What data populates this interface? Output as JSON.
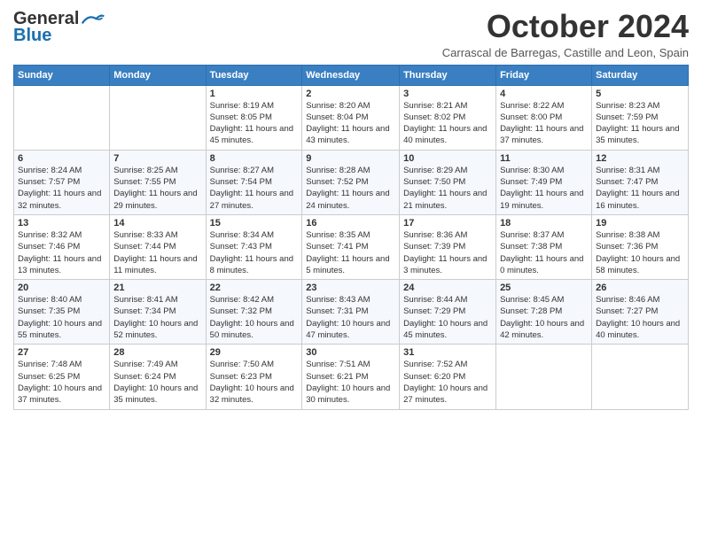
{
  "header": {
    "logo_general": "General",
    "logo_blue": "Blue",
    "month_title": "October 2024",
    "subtitle": "Carrascal de Barregas, Castille and Leon, Spain"
  },
  "days_of_week": [
    "Sunday",
    "Monday",
    "Tuesday",
    "Wednesday",
    "Thursday",
    "Friday",
    "Saturday"
  ],
  "weeks": [
    [
      {
        "day": "",
        "info": ""
      },
      {
        "day": "",
        "info": ""
      },
      {
        "day": "1",
        "info": "Sunrise: 8:19 AM\nSunset: 8:05 PM\nDaylight: 11 hours and 45 minutes."
      },
      {
        "day": "2",
        "info": "Sunrise: 8:20 AM\nSunset: 8:04 PM\nDaylight: 11 hours and 43 minutes."
      },
      {
        "day": "3",
        "info": "Sunrise: 8:21 AM\nSunset: 8:02 PM\nDaylight: 11 hours and 40 minutes."
      },
      {
        "day": "4",
        "info": "Sunrise: 8:22 AM\nSunset: 8:00 PM\nDaylight: 11 hours and 37 minutes."
      },
      {
        "day": "5",
        "info": "Sunrise: 8:23 AM\nSunset: 7:59 PM\nDaylight: 11 hours and 35 minutes."
      }
    ],
    [
      {
        "day": "6",
        "info": "Sunrise: 8:24 AM\nSunset: 7:57 PM\nDaylight: 11 hours and 32 minutes."
      },
      {
        "day": "7",
        "info": "Sunrise: 8:25 AM\nSunset: 7:55 PM\nDaylight: 11 hours and 29 minutes."
      },
      {
        "day": "8",
        "info": "Sunrise: 8:27 AM\nSunset: 7:54 PM\nDaylight: 11 hours and 27 minutes."
      },
      {
        "day": "9",
        "info": "Sunrise: 8:28 AM\nSunset: 7:52 PM\nDaylight: 11 hours and 24 minutes."
      },
      {
        "day": "10",
        "info": "Sunrise: 8:29 AM\nSunset: 7:50 PM\nDaylight: 11 hours and 21 minutes."
      },
      {
        "day": "11",
        "info": "Sunrise: 8:30 AM\nSunset: 7:49 PM\nDaylight: 11 hours and 19 minutes."
      },
      {
        "day": "12",
        "info": "Sunrise: 8:31 AM\nSunset: 7:47 PM\nDaylight: 11 hours and 16 minutes."
      }
    ],
    [
      {
        "day": "13",
        "info": "Sunrise: 8:32 AM\nSunset: 7:46 PM\nDaylight: 11 hours and 13 minutes."
      },
      {
        "day": "14",
        "info": "Sunrise: 8:33 AM\nSunset: 7:44 PM\nDaylight: 11 hours and 11 minutes."
      },
      {
        "day": "15",
        "info": "Sunrise: 8:34 AM\nSunset: 7:43 PM\nDaylight: 11 hours and 8 minutes."
      },
      {
        "day": "16",
        "info": "Sunrise: 8:35 AM\nSunset: 7:41 PM\nDaylight: 11 hours and 5 minutes."
      },
      {
        "day": "17",
        "info": "Sunrise: 8:36 AM\nSunset: 7:39 PM\nDaylight: 11 hours and 3 minutes."
      },
      {
        "day": "18",
        "info": "Sunrise: 8:37 AM\nSunset: 7:38 PM\nDaylight: 11 hours and 0 minutes."
      },
      {
        "day": "19",
        "info": "Sunrise: 8:38 AM\nSunset: 7:36 PM\nDaylight: 10 hours and 58 minutes."
      }
    ],
    [
      {
        "day": "20",
        "info": "Sunrise: 8:40 AM\nSunset: 7:35 PM\nDaylight: 10 hours and 55 minutes."
      },
      {
        "day": "21",
        "info": "Sunrise: 8:41 AM\nSunset: 7:34 PM\nDaylight: 10 hours and 52 minutes."
      },
      {
        "day": "22",
        "info": "Sunrise: 8:42 AM\nSunset: 7:32 PM\nDaylight: 10 hours and 50 minutes."
      },
      {
        "day": "23",
        "info": "Sunrise: 8:43 AM\nSunset: 7:31 PM\nDaylight: 10 hours and 47 minutes."
      },
      {
        "day": "24",
        "info": "Sunrise: 8:44 AM\nSunset: 7:29 PM\nDaylight: 10 hours and 45 minutes."
      },
      {
        "day": "25",
        "info": "Sunrise: 8:45 AM\nSunset: 7:28 PM\nDaylight: 10 hours and 42 minutes."
      },
      {
        "day": "26",
        "info": "Sunrise: 8:46 AM\nSunset: 7:27 PM\nDaylight: 10 hours and 40 minutes."
      }
    ],
    [
      {
        "day": "27",
        "info": "Sunrise: 7:48 AM\nSunset: 6:25 PM\nDaylight: 10 hours and 37 minutes."
      },
      {
        "day": "28",
        "info": "Sunrise: 7:49 AM\nSunset: 6:24 PM\nDaylight: 10 hours and 35 minutes."
      },
      {
        "day": "29",
        "info": "Sunrise: 7:50 AM\nSunset: 6:23 PM\nDaylight: 10 hours and 32 minutes."
      },
      {
        "day": "30",
        "info": "Sunrise: 7:51 AM\nSunset: 6:21 PM\nDaylight: 10 hours and 30 minutes."
      },
      {
        "day": "31",
        "info": "Sunrise: 7:52 AM\nSunset: 6:20 PM\nDaylight: 10 hours and 27 minutes."
      },
      {
        "day": "",
        "info": ""
      },
      {
        "day": "",
        "info": ""
      }
    ]
  ]
}
